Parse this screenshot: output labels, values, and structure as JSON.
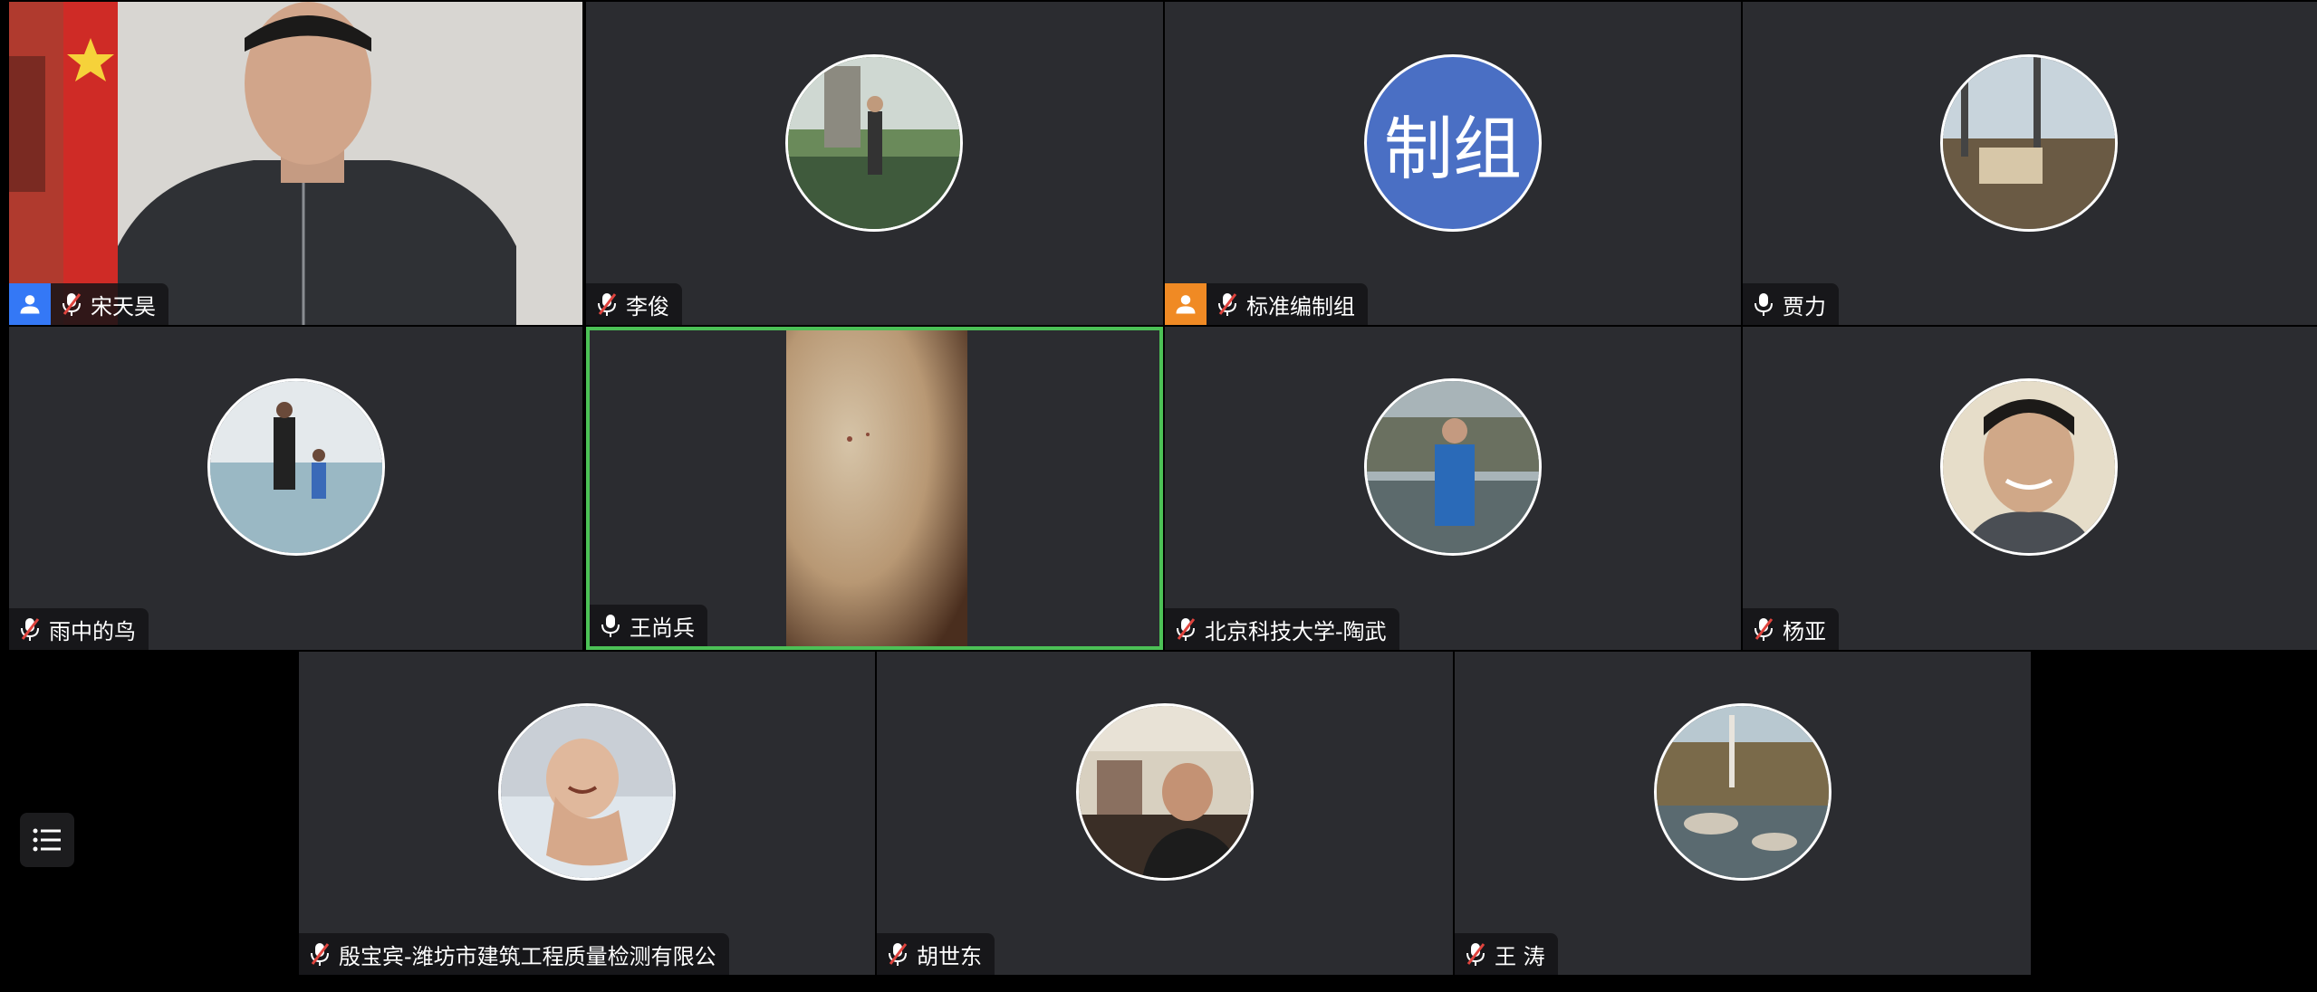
{
  "participants": [
    {
      "name": "宋天昊",
      "badge": "blue",
      "mic": "muted",
      "type": "video"
    },
    {
      "name": "李俊",
      "mic": "muted",
      "type": "avatar",
      "avatar_desc": "man standing by lake"
    },
    {
      "name": "标准编制组",
      "badge": "orange",
      "mic": "muted",
      "type": "text",
      "avatar_text": "制组"
    },
    {
      "name": "贾力",
      "mic": "on",
      "type": "avatar",
      "avatar_desc": "window view"
    },
    {
      "name": "雨中的鸟",
      "mic": "muted",
      "type": "avatar",
      "avatar_desc": "beach"
    },
    {
      "name": "王尚兵",
      "mic": "on",
      "type": "video",
      "active": true
    },
    {
      "name": "北京科技大学-陶武",
      "mic": "muted",
      "type": "avatar",
      "avatar_desc": "man outdoors"
    },
    {
      "name": "杨亚",
      "mic": "muted",
      "type": "avatar",
      "avatar_desc": "smiling man"
    },
    {
      "name": "殷宝宾-潍坊市建筑工程质量检测有限公",
      "mic": "muted",
      "type": "avatar",
      "avatar_desc": "baby in bath"
    },
    {
      "name": "胡世东",
      "mic": "muted",
      "type": "avatar",
      "avatar_desc": "man indoors"
    },
    {
      "name": "王 涛",
      "mic": "muted",
      "type": "avatar",
      "avatar_desc": "creek landscape"
    }
  ],
  "colors": {
    "tile_bg": "#2b2c30",
    "active_border": "#4cc156",
    "host_blue": "#3478f6",
    "cohost_orange": "#f08a24",
    "text_avatar_bg": "#4a6fc4"
  },
  "sidebar_button": {
    "icon": "list-icon"
  }
}
